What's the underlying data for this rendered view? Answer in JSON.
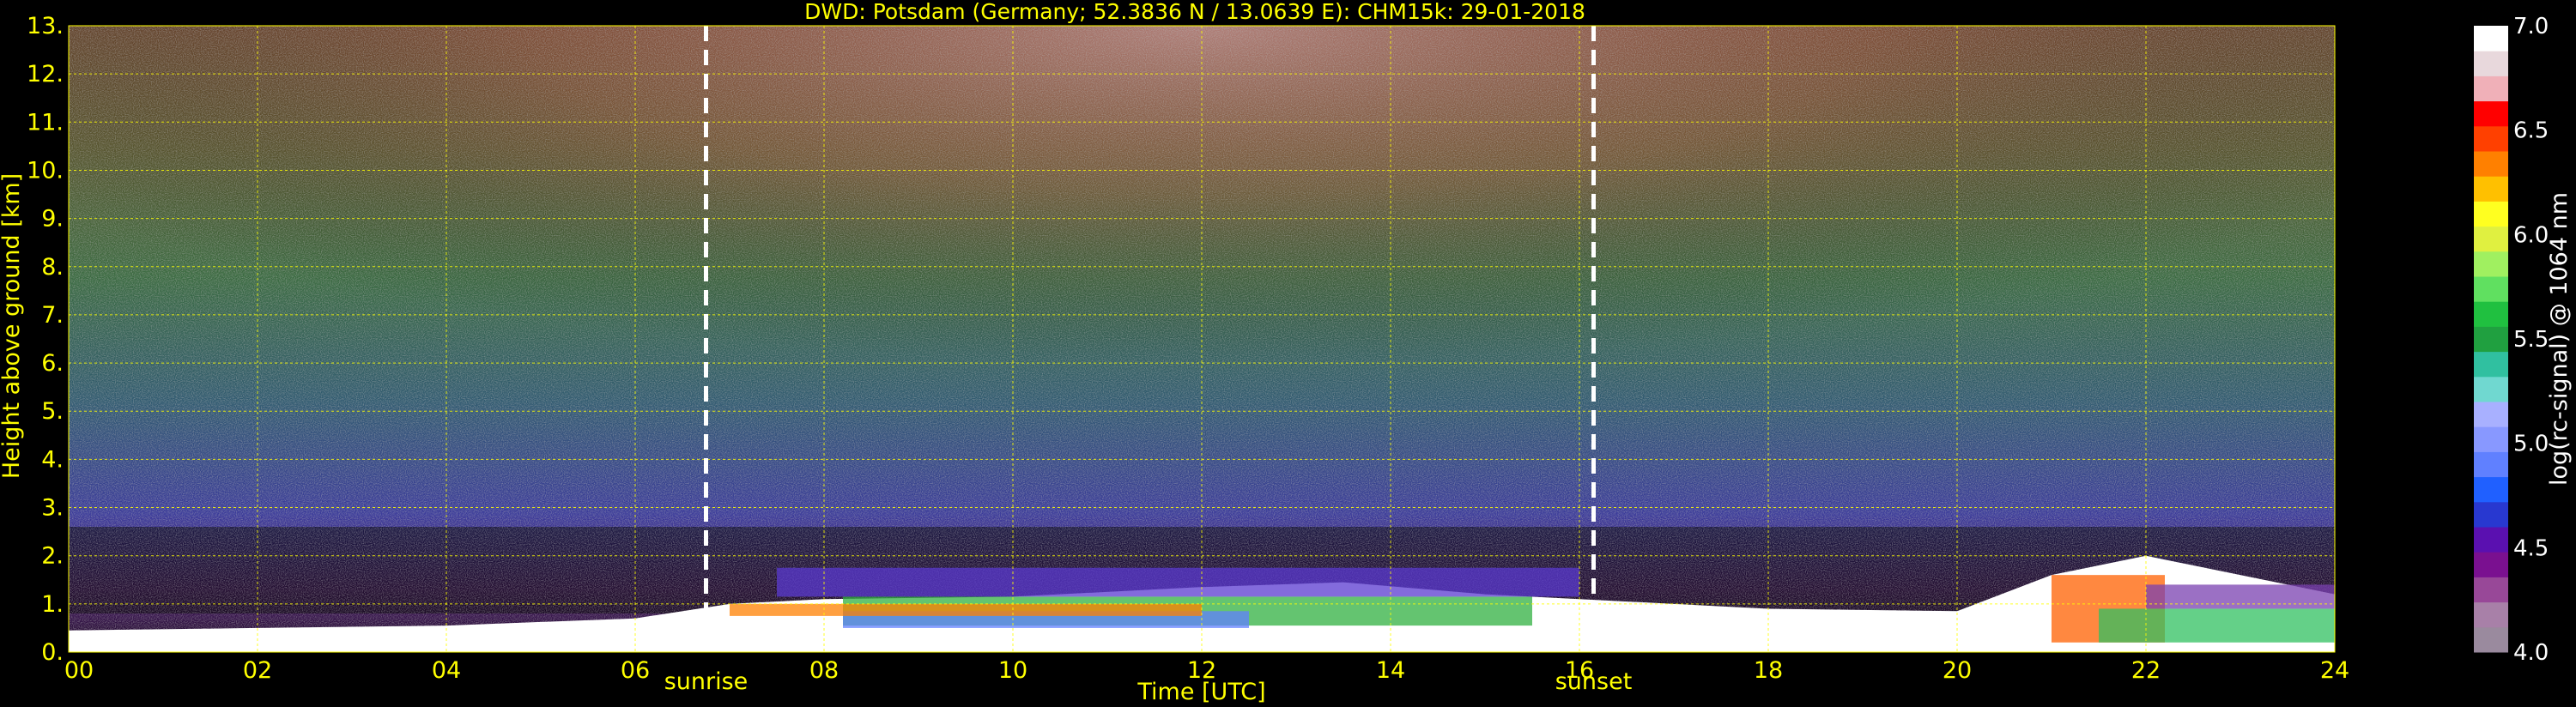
{
  "colors": {
    "background": "#000000",
    "text": "#ffff00",
    "grid": "#ffff00",
    "marker_line": "#ffffff",
    "colorbar_text": "#ffffff"
  },
  "chart_data": {
    "type": "heatmap",
    "title": "DWD: Potsdam (Germany; 52.3836 N / 13.0639 E):    CHM15k: 29-01-2018",
    "xlabel": "Time [UTC]",
    "ylabel": "Height above ground [km]",
    "xlim": [
      0,
      24
    ],
    "ylim": [
      0,
      13
    ],
    "grid": true,
    "x_ticks": [
      0,
      2,
      4,
      6,
      8,
      10,
      12,
      14,
      16,
      18,
      20,
      22,
      24
    ],
    "x_tick_labels": [
      "00",
      "02",
      "04",
      "06",
      "08",
      "10",
      "12",
      "14",
      "16",
      "18",
      "20",
      "22",
      "24"
    ],
    "y_ticks": [
      0,
      1,
      2,
      3,
      4,
      5,
      6,
      7,
      8,
      9,
      10,
      11,
      12,
      13
    ],
    "y_tick_labels": [
      "0.",
      "1.",
      "2.",
      "3.",
      "4.",
      "5.",
      "6.",
      "7.",
      "8.",
      "9.",
      "10.",
      "11.",
      "12.",
      "13."
    ],
    "markers": [
      {
        "label": "sunrise",
        "x": 6.75
      },
      {
        "label": "sunset",
        "x": 16.15
      }
    ],
    "colorbar": {
      "label": "log(rc-signal) @ 1064 nm",
      "range": [
        4.0,
        7.0
      ],
      "ticks": [
        4.0,
        4.5,
        5.0,
        5.5,
        6.0,
        6.5,
        7.0
      ],
      "tick_labels": [
        "4.0",
        "4.5",
        "5.0",
        "5.5",
        "6.0",
        "6.5",
        "7.0"
      ],
      "colors": [
        "#9a8a9e",
        "#a880a8",
        "#984898",
        "#7a1090",
        "#5a10b0",
        "#2838d0",
        "#2060ff",
        "#6080ff",
        "#8898ff",
        "#a8b0ff",
        "#70d8d0",
        "#30c0a0",
        "#20a040",
        "#20c040",
        "#60e060",
        "#a0f060",
        "#e0f040",
        "#ffff20",
        "#ffc000",
        "#ff8000",
        "#ff4000",
        "#ff0000",
        "#f0b0b8",
        "#e8d8dc",
        "#ffffff"
      ]
    },
    "features": {
      "boundary_layer_top_km": [
        {
          "t": 0,
          "h": 0.45
        },
        {
          "t": 2,
          "h": 0.5
        },
        {
          "t": 4,
          "h": 0.55
        },
        {
          "t": 6,
          "h": 0.7
        },
        {
          "t": 7,
          "h": 1.0
        },
        {
          "t": 8,
          "h": 1.1
        },
        {
          "t": 10,
          "h": 1.15
        },
        {
          "t": 12,
          "h": 1.35
        },
        {
          "t": 13.5,
          "h": 1.45
        },
        {
          "t": 15,
          "h": 1.2
        },
        {
          "t": 16,
          "h": 1.1
        },
        {
          "t": 18,
          "h": 0.9
        },
        {
          "t": 20,
          "h": 0.85
        },
        {
          "t": 21,
          "h": 1.6
        },
        {
          "t": 22,
          "h": 2.0
        },
        {
          "t": 24,
          "h": 1.2
        }
      ]
    }
  }
}
